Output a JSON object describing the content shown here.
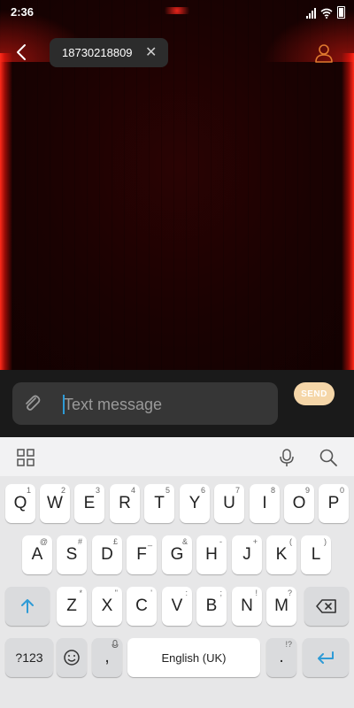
{
  "status_bar": {
    "time": "2:36"
  },
  "header": {
    "recipient": "18730218809",
    "remove_symbol": "✕"
  },
  "compose": {
    "placeholder": "Text message",
    "send_label": "SEND"
  },
  "keyboard": {
    "row1": [
      {
        "key": "Q",
        "hint": "1"
      },
      {
        "key": "W",
        "hint": "2"
      },
      {
        "key": "E",
        "hint": "3"
      },
      {
        "key": "R",
        "hint": "4"
      },
      {
        "key": "T",
        "hint": "5"
      },
      {
        "key": "Y",
        "hint": "6"
      },
      {
        "key": "U",
        "hint": "7"
      },
      {
        "key": "I",
        "hint": "8"
      },
      {
        "key": "O",
        "hint": "9"
      },
      {
        "key": "P",
        "hint": "0"
      }
    ],
    "row2": [
      {
        "key": "A",
        "hint": "@"
      },
      {
        "key": "S",
        "hint": "#"
      },
      {
        "key": "D",
        "hint": "£"
      },
      {
        "key": "F",
        "hint": "_"
      },
      {
        "key": "G",
        "hint": "&"
      },
      {
        "key": "H",
        "hint": "-"
      },
      {
        "key": "J",
        "hint": "+"
      },
      {
        "key": "K",
        "hint": "("
      },
      {
        "key": "L",
        "hint": ")"
      }
    ],
    "row3": [
      {
        "key": "Z",
        "hint": "*"
      },
      {
        "key": "X",
        "hint": "\""
      },
      {
        "key": "C",
        "hint": "'"
      },
      {
        "key": "V",
        "hint": ":"
      },
      {
        "key": "B",
        "hint": ";"
      },
      {
        "key": "N",
        "hint": "!"
      },
      {
        "key": "M",
        "hint": "?"
      }
    ],
    "symbols_label": "?123",
    "comma": ",",
    "space_label": "English (UK)",
    "period": ".",
    "period_hint": "!?"
  },
  "colors": {
    "accent": "#2e9bd6",
    "send_button": "#f5d6a8",
    "theme_red": "#ff2a1a",
    "contact_icon": "#e07a2f"
  },
  "icons": [
    "back-arrow-icon",
    "contact-icon",
    "attach-icon",
    "grid-icon",
    "microphone-icon",
    "search-icon",
    "shift-icon",
    "backspace-icon",
    "emoji-icon",
    "enter-icon",
    "wifi-icon",
    "signal-icon",
    "battery-icon"
  ]
}
